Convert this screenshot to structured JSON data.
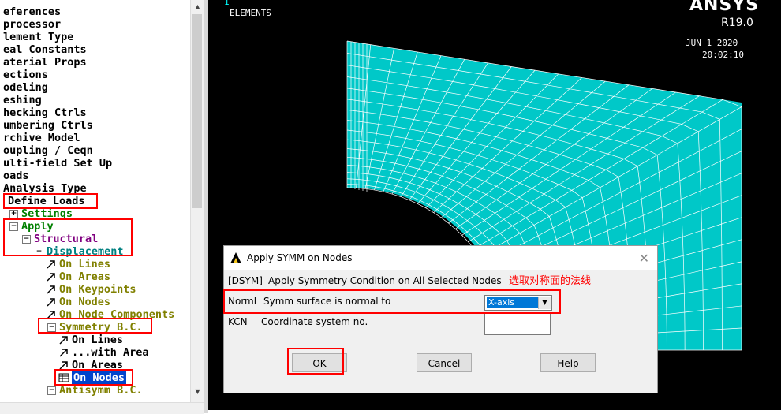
{
  "tree": {
    "items": [
      {
        "label": "eferences",
        "color": "black"
      },
      {
        "label": "processor",
        "color": "black"
      },
      {
        "label": "lement Type",
        "color": "black"
      },
      {
        "label": "eal Constants",
        "color": "black"
      },
      {
        "label": "aterial Props",
        "color": "black"
      },
      {
        "label": "ections",
        "color": "black"
      },
      {
        "label": "odeling",
        "color": "black"
      },
      {
        "label": "eshing",
        "color": "black"
      },
      {
        "label": "hecking Ctrls",
        "color": "black"
      },
      {
        "label": "umbering Ctrls",
        "color": "black"
      },
      {
        "label": "rchive Model",
        "color": "black"
      },
      {
        "label": "oupling / Ceqn",
        "color": "black"
      },
      {
        "label": "ulti-field Set Up",
        "color": "black"
      },
      {
        "label": "oads",
        "color": "black"
      },
      {
        "label": "Analysis Type",
        "color": "black"
      },
      {
        "label": "Define Loads",
        "color": "black"
      },
      {
        "label": "Settings",
        "color": "green"
      },
      {
        "label": "Apply",
        "color": "green"
      },
      {
        "label": "Structural",
        "color": "purple"
      },
      {
        "label": "Displacement",
        "color": "teal"
      },
      {
        "label": "On Lines",
        "color": "olive"
      },
      {
        "label": "On Areas",
        "color": "olive"
      },
      {
        "label": "On Keypoints",
        "color": "olive"
      },
      {
        "label": "On Nodes",
        "color": "olive"
      },
      {
        "label": "On Node Components",
        "color": "olive"
      },
      {
        "label": "Symmetry B.C.",
        "color": "olive"
      },
      {
        "label": "On Lines",
        "color": "black"
      },
      {
        "label": "...with Area",
        "color": "black"
      },
      {
        "label": "On Areas",
        "color": "black"
      },
      {
        "label": "On Nodes",
        "color": "selected"
      },
      {
        "label": "Antisymm B.C.",
        "color": "olive"
      }
    ]
  },
  "graphics": {
    "label": "ELEMENTS",
    "brand": "ANSYS",
    "version": "R19.0",
    "date": "JUN  1 2020",
    "time": "20:02:10",
    "mesh_color": "#00c8c8",
    "cursor": "1"
  },
  "dialog": {
    "title": "Apply SYMM on Nodes",
    "row1_code": "[DSYM]",
    "row1_text": "Apply Symmetry Condition on All Selected Nodes",
    "annotation": "选取对称面的法线",
    "row2_code": "Norml",
    "row2_text": "Symm surface is normal to",
    "select_value": "X-axis",
    "row3_code": "KCN",
    "row3_text": "Coordinate system no.",
    "ok_label": "OK",
    "cancel_label": "Cancel",
    "help_label": "Help",
    "close_glyph": "✕"
  },
  "colors": {
    "highlight": "#ff0000",
    "annotation": "#ff0000"
  }
}
